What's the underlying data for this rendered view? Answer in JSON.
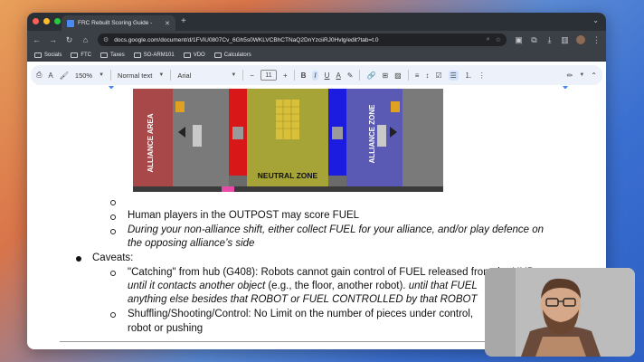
{
  "browser": {
    "tab_title": "FRC Rebuilt Scoring Guide -",
    "url": "docs.google.com/document/d/1FViU0807Cv_6Gh5s0WKLVCBhCTNaQ2DnYzciiRJ0Hvlg/edit?tab=t.0",
    "bookmarks": [
      "Socials",
      "FTC",
      "Taxes",
      "SO-ARM101",
      "VDO",
      "Calculators"
    ]
  },
  "toolbar": {
    "zoom": "150%",
    "style": "Normal text",
    "font": "Arial",
    "font_size": "11"
  },
  "figure": {
    "alliance_area": "ALLIANCE AREA",
    "neutral_zone": "NEUTRAL ZONE",
    "alliance_zone": "ALLIANCE ZONE"
  },
  "doc": {
    "line_human": "Human players in the OUTPOST may score FUEL",
    "line_shift_1": "During your non-alliance shift, either collect FUEL for your alliance, and/or play defence on",
    "line_shift_2": "the opposing alliance’s side",
    "caveats": "Caveats:",
    "catch_1": "\"Catching\" from hub (G408): Robots cannot gain control of FUEL released from the HUB",
    "catch_2a": "until it contacts another object",
    "catch_2b": " (e.g., the floor, another robot). ",
    "catch_2c": "until that FUEL",
    "catch_3": "anything else besides that ROBOT or FUEL CONTROLLED by that ROBOT",
    "shuffle_1": "Shuffling/Shooting/Control: No Limit on the number of pieces under control,",
    "shuffle_2": "robot or pushing"
  },
  "colors": {
    "red_alliance": "#c0392b",
    "blue_alliance": "#2f2fc0",
    "neutral": "#a8a832"
  }
}
